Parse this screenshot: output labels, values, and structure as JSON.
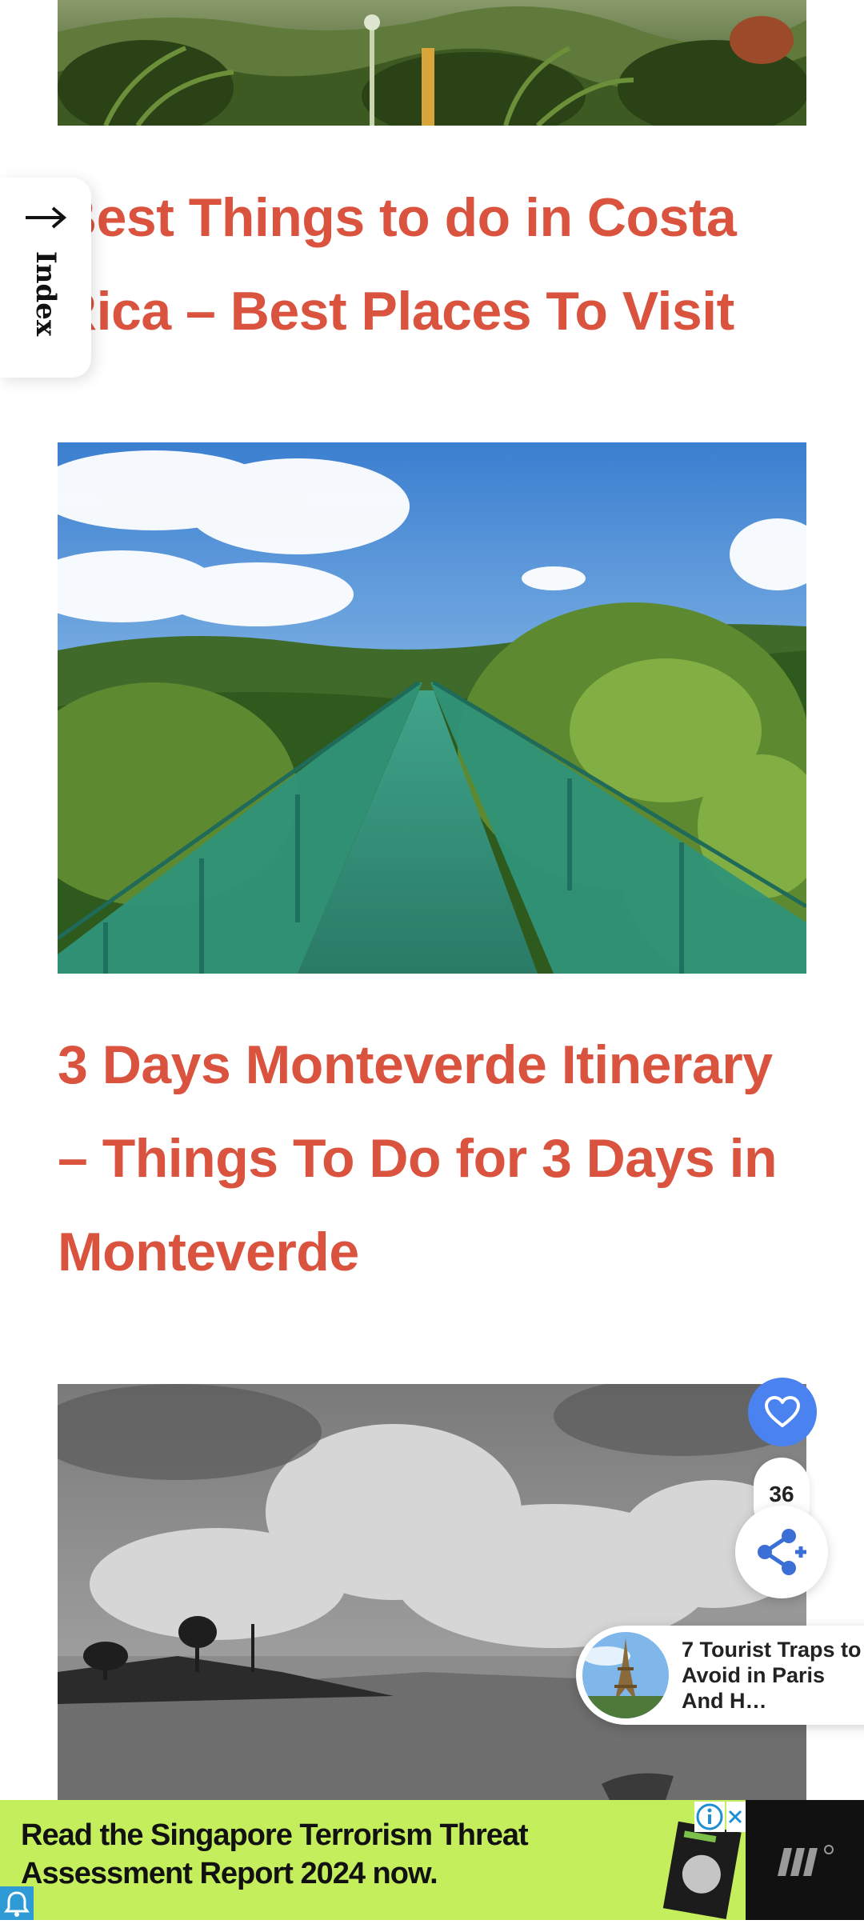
{
  "articles": [
    {
      "title": "Best Things to do in Costa Rica – Best Places To Visit",
      "image": "tropical-garden-photo"
    },
    {
      "title": "3 Days Monteverde Itinerary – Things To Do for 3 Days in Monteverde",
      "image": "hanging-bridge-photo"
    },
    {
      "title": "",
      "image": "lake-grayscale-photo"
    }
  ],
  "index_tab": {
    "label": "Index",
    "icon": "arrow-up-icon"
  },
  "floating_actions": {
    "like_count": "36",
    "like_icon": "heart-icon",
    "share_icon": "share-plus-icon",
    "like_color": "#4a82f0"
  },
  "recommendation": {
    "title": "7 Tourist Traps to Avoid in Paris And H…",
    "thumbnail": "eiffel-tower-thumbnail"
  },
  "ad": {
    "text": "Read the Singapore Terrorism Threat Assessment Report 2024 now.",
    "background": "#c5ee5c",
    "info_icon": "info-icon",
    "close_icon": "close-icon",
    "logo": "brand-logo-icon"
  },
  "colors": {
    "title": "#d9533f",
    "accent": "#4a82f0"
  }
}
